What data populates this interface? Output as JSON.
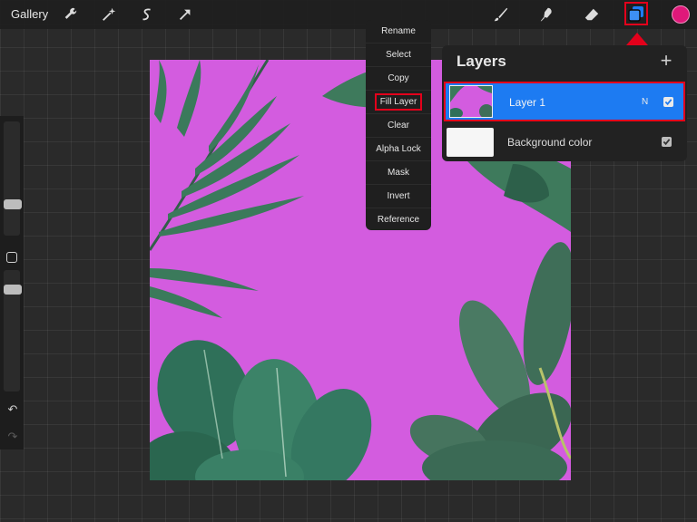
{
  "topbar": {
    "gallery_label": "Gallery",
    "tools": [
      "wrench-icon",
      "magic-wand-icon",
      "selection-icon",
      "transform-arrow-icon",
      "brush-icon",
      "smudge-icon",
      "eraser-icon",
      "layers-icon"
    ],
    "current_color": "#e0187a"
  },
  "context_menu": {
    "items": [
      "Rename",
      "Select",
      "Copy",
      "Fill Layer",
      "Clear",
      "Alpha Lock",
      "Mask",
      "Invert",
      "Reference"
    ],
    "highlighted": "Fill Layer"
  },
  "layers_panel": {
    "title": "Layers",
    "add_label": "+",
    "layers": [
      {
        "name": "Layer 1",
        "blend_mode": "N",
        "visible": true,
        "active": true
      },
      {
        "name": "Background color",
        "visible": true,
        "active": false
      }
    ]
  },
  "canvas": {
    "background_color": "#d35cdf"
  },
  "colors": {
    "accent": "#1d7bf2",
    "annotation": "#e3001b"
  }
}
